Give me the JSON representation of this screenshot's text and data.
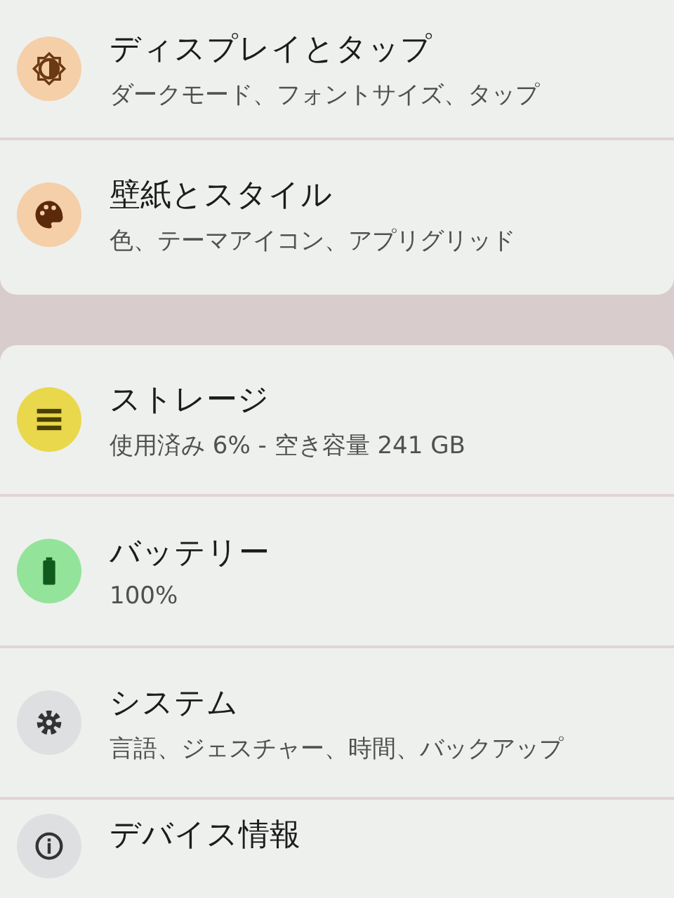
{
  "groups": [
    {
      "items": [
        {
          "kind": "display",
          "title": "ディスプレイとタップ",
          "subtitle": "ダークモード、フォントサイズ、タップ"
        },
        {
          "kind": "palette",
          "title": "壁紙とスタイル",
          "subtitle": "色、テーマアイコン、アプリグリッド"
        }
      ]
    },
    {
      "items": [
        {
          "kind": "storage",
          "title": "ストレージ",
          "subtitle": "使用済み 6% - 空き容量 241 GB"
        },
        {
          "kind": "battery",
          "title": "バッテリー",
          "subtitle": "100%"
        },
        {
          "kind": "system",
          "title": "システム",
          "subtitle": "言語、ジェスチャー、時間、バックアップ"
        },
        {
          "kind": "info",
          "title": "デバイス情報"
        }
      ]
    }
  ]
}
